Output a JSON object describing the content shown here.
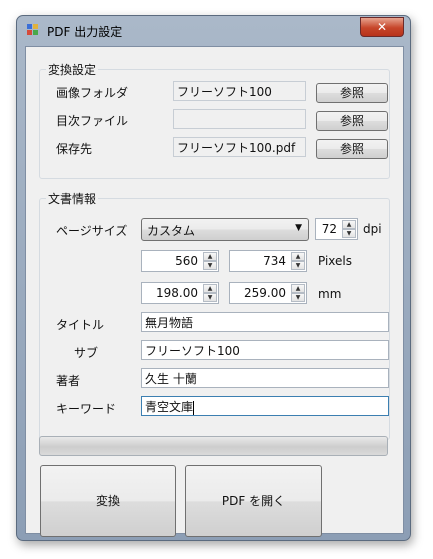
{
  "window": {
    "title": "PDF 出力設定",
    "close_label": "✕"
  },
  "conversion": {
    "legend": "変換設定",
    "rows": [
      {
        "label": "画像フォルダ",
        "value": "フリーソフト100",
        "button": "参照"
      },
      {
        "label": "目次ファイル",
        "value": "",
        "button": "参照"
      },
      {
        "label": "保存先",
        "value": "フリーソフト100.pdf",
        "button": "参照"
      }
    ]
  },
  "document": {
    "legend": "文書情報",
    "page_size_label": "ページサイズ",
    "page_size_value": "カスタム",
    "dpi_value": "72",
    "dpi_unit": "dpi",
    "pixels": {
      "width": "560",
      "height": "734",
      "unit": "Pixels"
    },
    "mm": {
      "width": "198.00",
      "height": "259.00",
      "unit": "mm"
    },
    "fields": [
      {
        "label": "タイトル",
        "value": "無月物語"
      },
      {
        "label": "サブ",
        "value": "フリーソフト100"
      },
      {
        "label": "著者",
        "value": "久生 十蘭"
      },
      {
        "label": "キーワード",
        "value": "青空文庫"
      }
    ]
  },
  "actions": {
    "convert": "変換",
    "open_pdf": "PDF を開く"
  },
  "progress_value": 0
}
